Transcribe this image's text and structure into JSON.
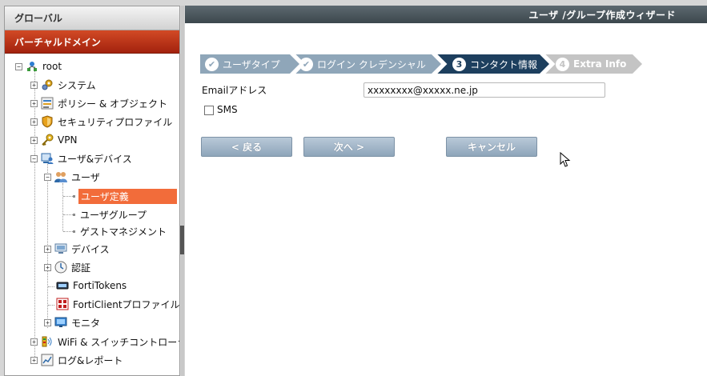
{
  "sidebar": {
    "global_label": "グローバル",
    "vdom_label": "バーチャルドメイン",
    "tree": {
      "root": "root",
      "system": "システム",
      "policy": "ポリシー & オブジェクト",
      "security_profile": "セキュリティプロファイル",
      "vpn": "VPN",
      "user_device": "ユーザ&デバイス",
      "user": "ユーザ",
      "user_definition": "ユーザ定義",
      "user_group": "ユーザグループ",
      "guest_management": "ゲストマネジメント",
      "device": "デバイス",
      "authentication": "認証",
      "fortitokens": "FortiTokens",
      "forticlient_profile": "FortiClientプロファイル",
      "monitor": "モニタ",
      "wifi_switch": "WiFi & スイッチコントローラー",
      "log_report": "ログ&レポート"
    }
  },
  "main": {
    "title": "ユーザ /グループ作成ウィザード",
    "steps": [
      {
        "label": "ユーザタイプ",
        "marker": "✔",
        "state": "done"
      },
      {
        "label": "ログイン クレデンシャル",
        "marker": "✔",
        "state": "done"
      },
      {
        "label": "コンタクト情報",
        "marker": "3",
        "state": "current"
      },
      {
        "label": "Extra Info",
        "marker": "4",
        "state": "pending"
      }
    ],
    "email_label": "Emailアドレス",
    "email_value": "xxxxxxxx@xxxxx.ne.jp",
    "sms_label": "SMS",
    "sms_checked": false,
    "back_button": "< 戻る",
    "next_button": "次へ >",
    "cancel_button": "キャンセル"
  },
  "colors": {
    "step_done": "#8fa6b9",
    "step_current": "#1d3f5e",
    "step_pending": "#c4c4c4",
    "selected_item": "#f26c3a",
    "vdom_bar": "#b8300f",
    "button": "#9fb3c6"
  }
}
